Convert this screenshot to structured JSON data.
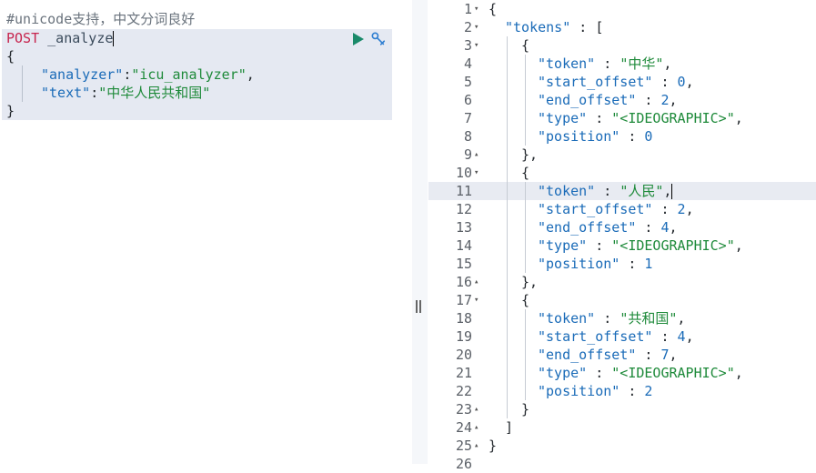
{
  "request": {
    "comment": "#unicode支持，中文分词良好",
    "method": "POST",
    "path": "_analyze",
    "open_brace": "{",
    "analyzer_key": "\"analyzer\"",
    "analyzer_value": "\"icu_analyzer\"",
    "text_key": "\"text\"",
    "text_value": "\"中华人民共和国\"",
    "close_brace": "}",
    "icons": {
      "run": "play-icon",
      "settings": "wrench-icon"
    }
  },
  "response": {
    "line_numbers": [
      "1",
      "2",
      "3",
      "4",
      "5",
      "6",
      "7",
      "8",
      "9",
      "10",
      "11",
      "12",
      "13",
      "14",
      "15",
      "16",
      "17",
      "18",
      "19",
      "20",
      "21",
      "22",
      "23",
      "24",
      "25",
      "26"
    ],
    "tokens_key": "\"tokens\"",
    "tokens": [
      {
        "token": "\"中华\"",
        "start_offset": "0",
        "end_offset": "2",
        "type": "\"<IDEOGRAPHIC>\"",
        "position": "0"
      },
      {
        "token": "\"人民\"",
        "start_offset": "2",
        "end_offset": "4",
        "type": "\"<IDEOGRAPHIC>\"",
        "position": "1"
      },
      {
        "token": "\"共和国\"",
        "start_offset": "4",
        "end_offset": "7",
        "type": "\"<IDEOGRAPHIC>\"",
        "position": "2"
      }
    ],
    "labels": {
      "token": "\"token\"",
      "start_offset": "\"start_offset\"",
      "end_offset": "\"end_offset\"",
      "type": "\"type\"",
      "position": "\"position\""
    }
  }
}
